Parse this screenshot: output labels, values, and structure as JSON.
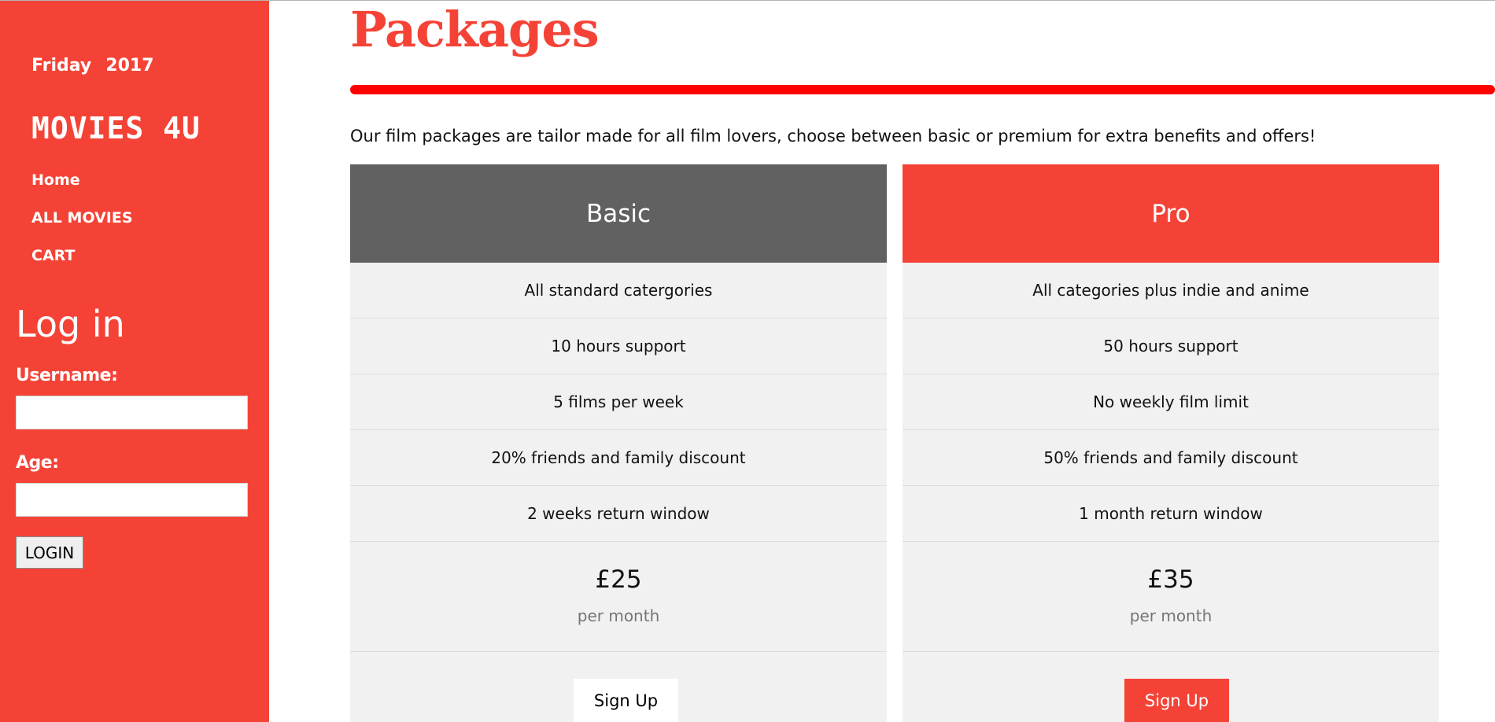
{
  "sidebar": {
    "date_day": "Friday",
    "date_year": "2017",
    "brand": "MOVIES 4U",
    "nav": [
      {
        "label": "Home"
      },
      {
        "label": "ALL MOVIES"
      },
      {
        "label": "CART"
      }
    ],
    "login": {
      "title": "Log in",
      "username_label": "Username:",
      "username_value": "",
      "age_label": "Age:",
      "age_value": "",
      "button_label": "LOGIN"
    }
  },
  "main": {
    "title": "Packages",
    "intro": "Our film packages are tailor made for all film lovers, choose between basic or premium for extra benefits and offers!",
    "packages": [
      {
        "name": "Basic",
        "features": [
          "All standard catergories",
          "10 hours support",
          "5 films per week",
          "20% friends and family discount",
          "2 weeks return window"
        ],
        "price": "£25",
        "period": "per month",
        "button_label": "Sign Up"
      },
      {
        "name": "Pro",
        "features": [
          "All categories plus indie and anime",
          "50 hours support",
          "No weekly film limit",
          "50% friends and family discount",
          "1 month return window"
        ],
        "price": "£35",
        "period": "per month",
        "button_label": "Sign Up"
      }
    ]
  },
  "colors": {
    "accent": "#f44336",
    "rule": "#ff0000",
    "basic_header": "#616161",
    "card_bg": "#f1f1f1"
  }
}
